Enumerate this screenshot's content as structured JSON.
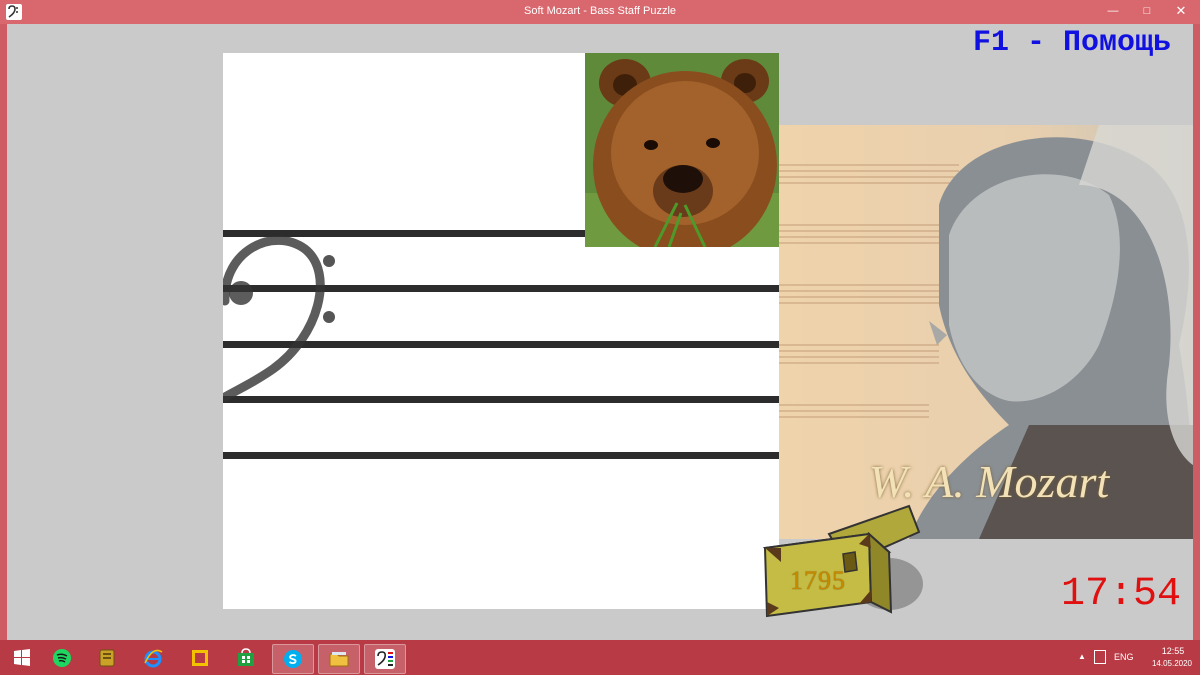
{
  "window": {
    "title": "Soft Mozart - Bass Staff Puzzle"
  },
  "hud": {
    "help": "F1 - Помощь",
    "timer": "17:54",
    "score": "1795"
  },
  "portrait": {
    "signature": "W. A. Mozart"
  },
  "tray": {
    "language": "ENG",
    "time": "12:55",
    "date": "14.05.2020"
  },
  "taskbar": {
    "items": [
      {
        "icon": "windows-start-icon",
        "color": "#ffffff"
      },
      {
        "icon": "spotify-icon",
        "color": "#1ed760"
      },
      {
        "icon": "archive-icon",
        "color": "#c9a227"
      },
      {
        "icon": "internet-explorer-icon",
        "color": "#1e90ff"
      },
      {
        "icon": "presentation-icon",
        "color": "#f2c200"
      },
      {
        "icon": "store-icon",
        "color": "#20a040"
      },
      {
        "icon": "skype-icon",
        "color": "#00aff0"
      },
      {
        "icon": "file-explorer-icon",
        "color": "#f0c040"
      },
      {
        "icon": "soft-mozart-icon",
        "color": "#ffffff"
      }
    ]
  },
  "colors": {
    "window_frame": "#cd5c64",
    "help_text": "#1010e0",
    "timer_text": "#e01010",
    "board_bg": "#ffffff",
    "client_bg": "#cacaca"
  }
}
